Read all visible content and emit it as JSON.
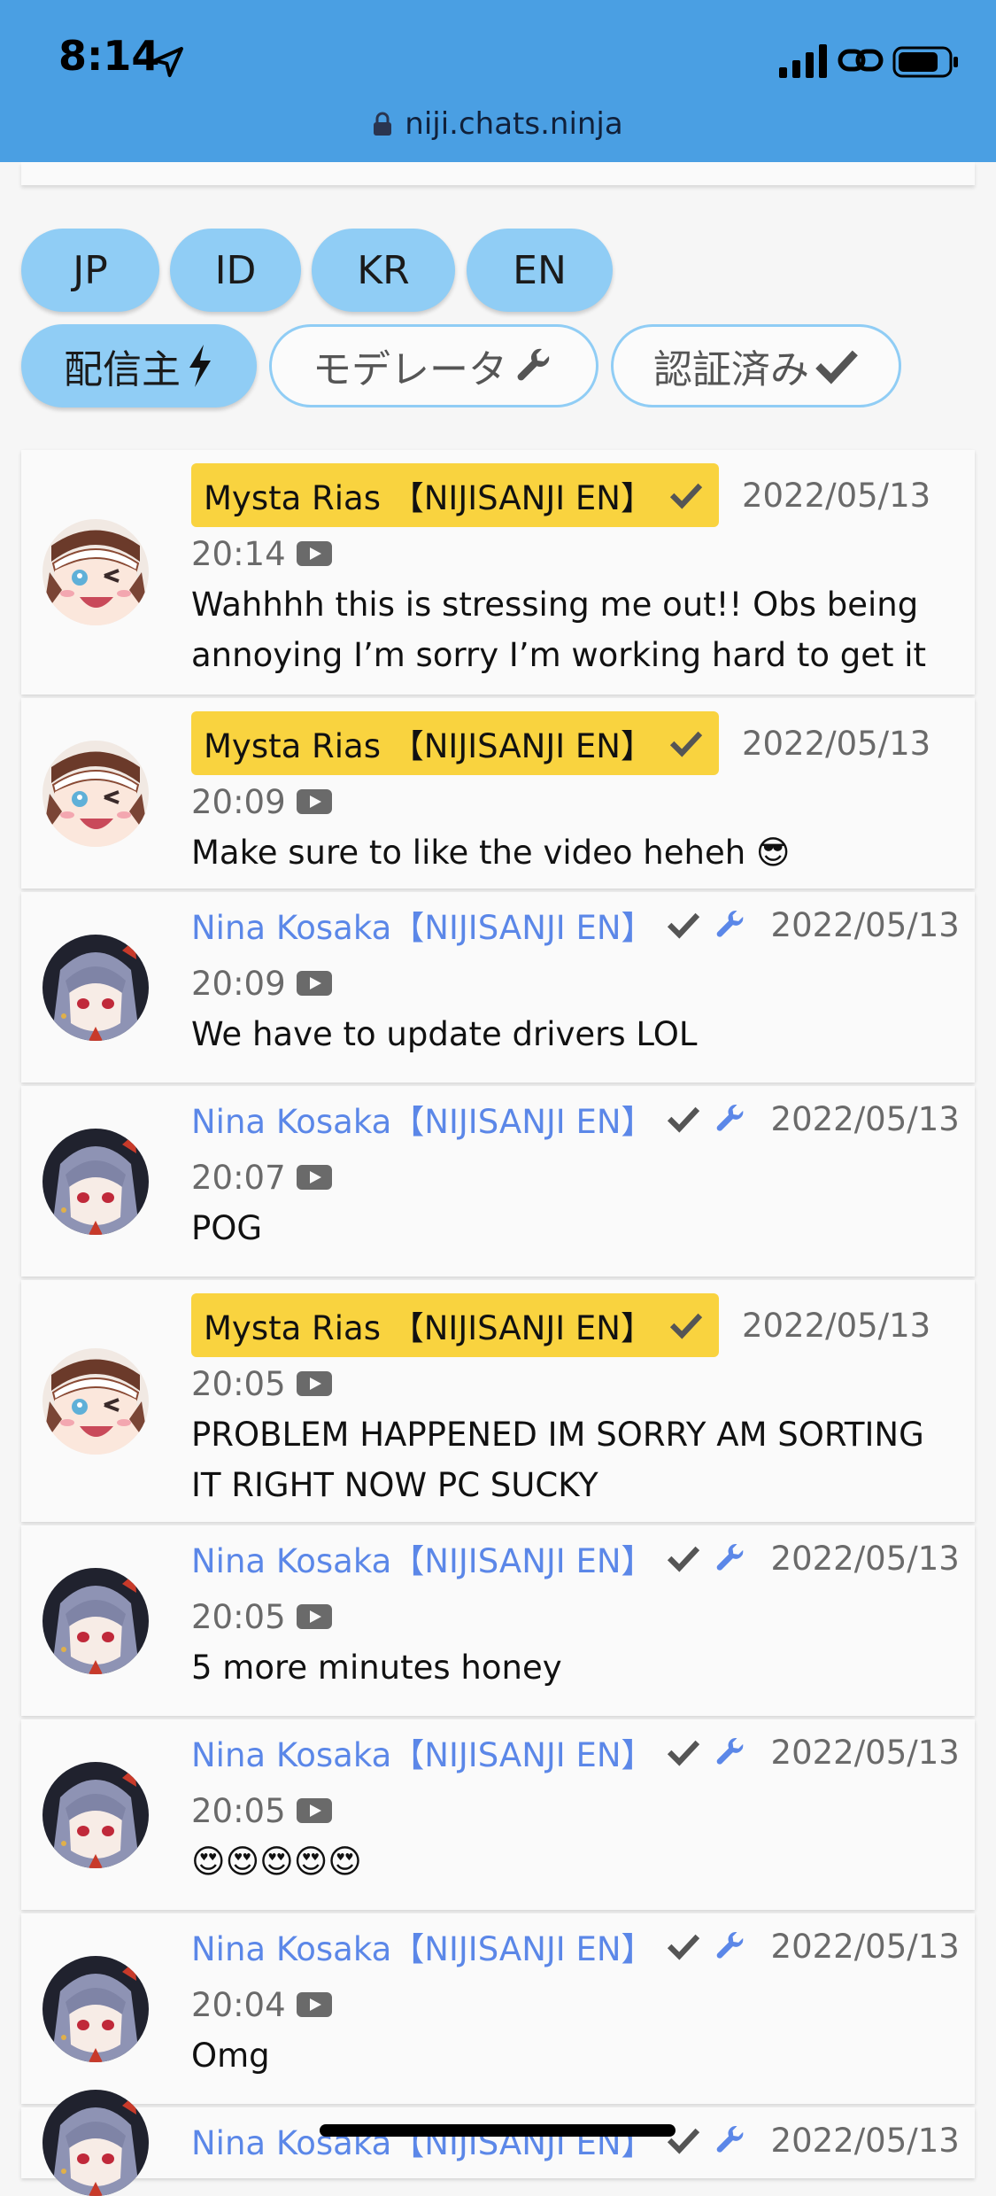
{
  "status_bar": {
    "time": "8:14"
  },
  "url_bar": {
    "url": "niji.chats.ninja"
  },
  "filters": {
    "languages": [
      "JP",
      "ID",
      "KR",
      "EN"
    ],
    "roles": [
      {
        "label": "配信主",
        "icon": "bolt-icon",
        "selected": true
      },
      {
        "label": "モデレータ",
        "icon": "wrench-icon",
        "selected": false
      },
      {
        "label": "認証済み",
        "icon": "check-icon",
        "selected": false
      }
    ]
  },
  "messages": [
    {
      "author": "Mysta Rias 【NIJISANJI EN】",
      "date": "2022/05/13",
      "time": "20:14",
      "text": "Wahhhh this is stressing me out!! Obs being annoying I’m sorry I’m working hard to get it up",
      "role": "owner"
    },
    {
      "author": "Mysta Rias 【NIJISANJI EN】",
      "date": "2022/05/13",
      "time": "20:09",
      "text": "Make sure to like the video heheh 😎",
      "role": "owner"
    },
    {
      "author": "Nina Kosaka【NIJISANJI EN】",
      "date": "2022/05/13",
      "time": "20:09",
      "text": "We have to update drivers LOL",
      "role": "moderator"
    },
    {
      "author": "Nina Kosaka【NIJISANJI EN】",
      "date": "2022/05/13",
      "time": "20:07",
      "text": "POG",
      "role": "moderator"
    },
    {
      "author": "Mysta Rias 【NIJISANJI EN】",
      "date": "2022/05/13",
      "time": "20:05",
      "text": "PROBLEM HAPPENED IM SORRY AM SORTING IT RIGHT NOW PC SUCKY",
      "role": "owner"
    },
    {
      "author": "Nina Kosaka【NIJISANJI EN】",
      "date": "2022/05/13",
      "time": "20:05",
      "text": "5 more minutes honey",
      "role": "moderator"
    },
    {
      "author": "Nina Kosaka【NIJISANJI EN】",
      "date": "2022/05/13",
      "time": "20:05",
      "text": "😍😍😍😍😍",
      "role": "moderator"
    },
    {
      "author": "Nina Kosaka【NIJISANJI EN】",
      "date": "2022/05/13",
      "time": "20:04",
      "text": "Omg",
      "role": "moderator"
    },
    {
      "author": "Nina Kosaka【NIJISANJI EN】",
      "date": "2022/05/13",
      "time": "",
      "text": "",
      "role": "moderator"
    }
  ],
  "colors": {
    "header": "#4a9fe3",
    "chip": "#90cdf5",
    "owner_badge": "#f9d33f",
    "moderator_name": "#5b87e8"
  }
}
